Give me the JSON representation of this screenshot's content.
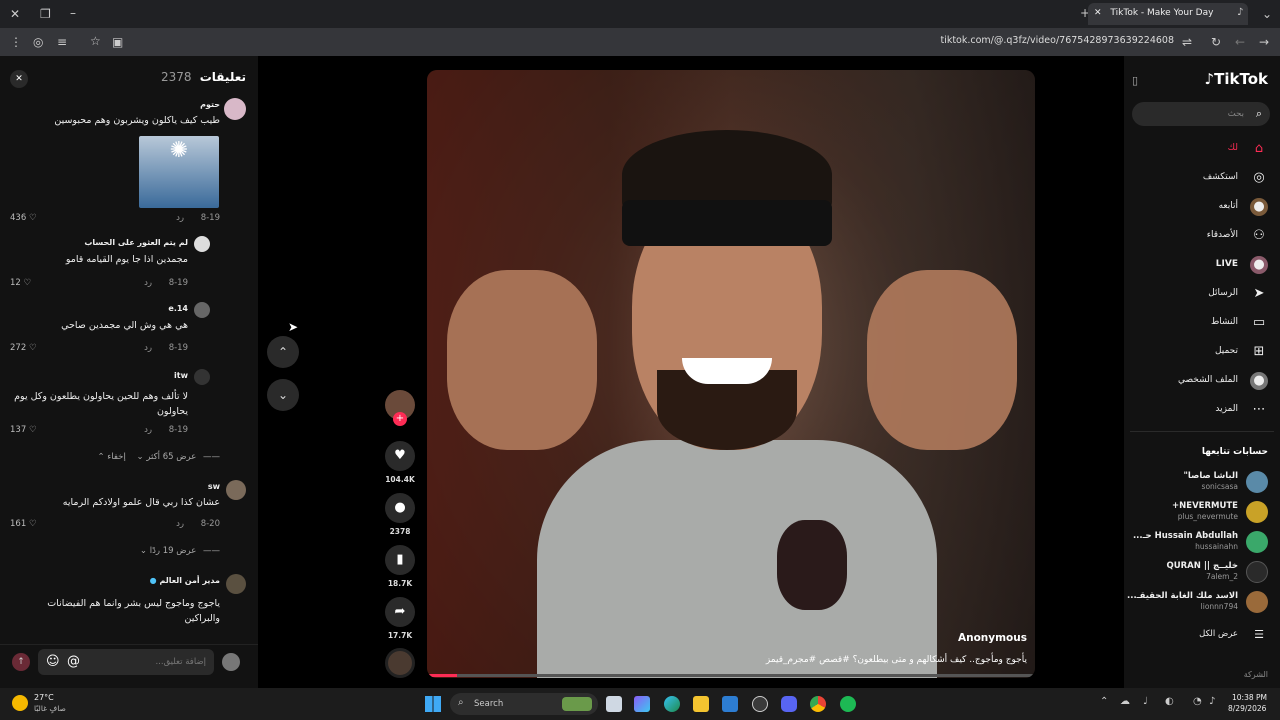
{
  "browser": {
    "tab_title": "TikTok - Make Your Day",
    "url": "tiktok.com/@.q3fz/video/7675428973639224608"
  },
  "comments_panel": {
    "title": "تعليقات",
    "count": "2378",
    "comments": [
      {
        "user": "حتوم",
        "text": "طيب كيف ياكلون ويشربون وهم محبوسين",
        "date": "8-19",
        "reply": "رد",
        "likes": "436"
      },
      {
        "user": "لم يتم العثور على الحساب",
        "text": "مجمدين اذا جا يوم القيامه قامو",
        "date": "8-19",
        "reply": "رد",
        "likes": "12"
      },
      {
        "user": "e.14",
        "text": "هي هي وش الي مجمدين صاحي",
        "date": "8-19",
        "reply": "رد",
        "likes": "272"
      },
      {
        "user": "itw",
        "text": "لا تألف وهم للحين يحاولون يطلعون وكل يوم يحاولون",
        "date": "8-19",
        "reply": "رد",
        "likes": "137"
      },
      {
        "user": "sw",
        "text": "عشان كذا ربي قال علمو اولادكم الرمايه",
        "date": "8-20",
        "reply": "رد",
        "likes": "161"
      },
      {
        "user": "مدير أمن العالم",
        "text": "ياجوج وماجوج ليس بشر وانما هم الفيضانات والبراكين",
        "date": "",
        "reply": "",
        "likes": ""
      }
    ],
    "replies_toggle_1": "عرض 65 أكثر",
    "hide_label": "إخفاء",
    "replies_toggle_2": "عرض 19 ردًا",
    "add_comment_placeholder": "إضافة تعليق..."
  },
  "video": {
    "author": "Anonymous",
    "caption": "يأجوج ومأجوج.. كيف أشكالهم و متى بيطلعون؟ #قصص #مجرم_قيمز",
    "likes": "104.4K",
    "comments": "2378",
    "saves": "18.7K",
    "shares": "17.7K"
  },
  "sidebar": {
    "logo": "TikTok",
    "search_placeholder": "بحث",
    "nav": [
      {
        "label": "لك",
        "icon": "home-icon"
      },
      {
        "label": "استكشف",
        "icon": "compass-icon"
      },
      {
        "label": "أتابعه",
        "icon": "following-icon"
      },
      {
        "label": "الأصدقاء",
        "icon": "friends-icon"
      },
      {
        "label": "LIVE",
        "icon": "live-icon"
      },
      {
        "label": "الرسائل",
        "icon": "messages-icon"
      },
      {
        "label": "النشاط",
        "icon": "activity-icon"
      },
      {
        "label": "تحميل",
        "icon": "upload-icon"
      },
      {
        "label": "الملف الشخصي",
        "icon": "profile-icon"
      },
      {
        "label": "المزيد",
        "icon": "more-icon"
      }
    ],
    "following_title": "حسابات تتابعها",
    "following": [
      {
        "name": "الباشا صاصا\"",
        "user": "sonicsasa"
      },
      {
        "name": "NEVERMUTE+",
        "user": "plus_nevermute"
      },
      {
        "name": "Hussain Abdullah حـ...",
        "user": "hussainahn"
      },
      {
        "name": "خليــج || QURAN",
        "user": "7alem_2"
      },
      {
        "name": "الاسد ملك الغابة الحقيقـ...",
        "user": "lionnn794"
      }
    ],
    "see_all": "عرض الكل",
    "company": "الشركة"
  },
  "taskbar": {
    "weather_temp": "27°C",
    "weather_desc": "صافٍ غالبًا",
    "search": "Search",
    "time": "10:38 PM",
    "date": "8/29/2026"
  }
}
